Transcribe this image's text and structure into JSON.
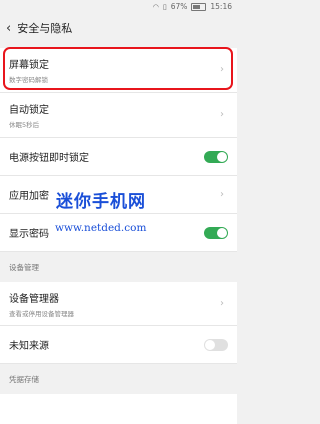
{
  "status_bar": {
    "battery": "67%",
    "time": "15:16"
  },
  "header": {
    "back_icon": "arrow-left-icon",
    "title": "安全与隐私"
  },
  "rows": {
    "screen_lock": {
      "title": "屏幕锁定",
      "subtitle": "数字密码解锁"
    },
    "auto_lock": {
      "title": "自动锁定",
      "subtitle": "休眠5秒后"
    },
    "power_lock": {
      "title": "电源按钮即时锁定",
      "toggle": true
    },
    "app_encrypt": {
      "title": "应用加密"
    },
    "show_password": {
      "title": "显示密码",
      "toggle": true
    },
    "device_manager": {
      "title": "设备管理器",
      "subtitle": "查看或停用设备管理器"
    },
    "unknown_sources": {
      "title": "未知来源",
      "toggle": false
    }
  },
  "sections": {
    "device_management": "设备管理",
    "credential_storage": "凭据存储"
  },
  "watermark": {
    "text": "迷你手机网",
    "url": "www.netded.com"
  },
  "colors": {
    "accent_green": "#33aa55",
    "highlight_red": "#e8151c",
    "watermark_blue": "#1a4fd8"
  }
}
